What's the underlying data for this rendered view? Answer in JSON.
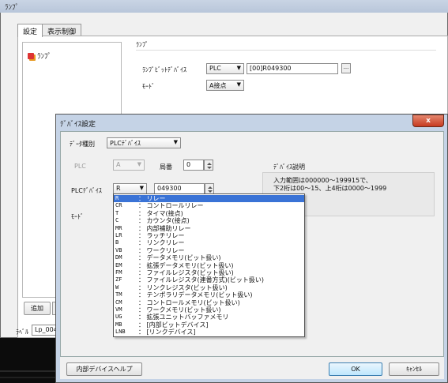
{
  "back_window": {
    "title": "ﾗﾝﾌﾟ",
    "tabs": [
      {
        "label": "設定",
        "active": true
      },
      {
        "label": "表示制御",
        "active": false
      }
    ],
    "tree_item": "ﾗﾝﾌﾟ",
    "group_title": "ﾗﾝﾌﾟ",
    "lamp_bit_device_label": "ﾗﾝﾌﾟﾋﾞｯﾄﾃﾞﾊﾞｲｽ",
    "plc_select_value": "PLC",
    "device_value": "[00]R049300",
    "browse_button": "...",
    "mode_label": "ﾓｰﾄﾞ",
    "mode_value": "A接点",
    "add_button": "追加",
    "label_label": "ﾗﾍﾞﾙ",
    "label_value": "Lp_004"
  },
  "dialog": {
    "title": "ﾃﾞﾊﾞｲｽ設定",
    "close_glyph": "x",
    "device_type_label": "ﾃﾞｰﾀ種別",
    "device_type_value": "PLCﾃﾞﾊﾞｲｽ",
    "plc_label": "PLC",
    "plc_value": "A",
    "station_label": "局番",
    "station_value": "0",
    "device_desc_label": "ﾃﾞﾊﾞｲｽ説明",
    "device_desc_text": "入力範囲は000000～199915で、\n下2桁は00～15、上4桁は0000～1999",
    "plc_device_label": "PLCﾃﾞﾊﾞｲｽ",
    "plc_device_value": "R",
    "address_value": "049300",
    "mode_label": "ﾓｰﾄﾞ",
    "dropdown_items": [
      {
        "code": "R",
        "desc": "： リレー",
        "selected": true
      },
      {
        "code": "CR",
        "desc": "： コントロールリレー",
        "selected": false
      },
      {
        "code": "T",
        "desc": "： タイマ(接点)",
        "selected": false
      },
      {
        "code": "C",
        "desc": "： カウンタ(接点)",
        "selected": false
      },
      {
        "code": "MR",
        "desc": "： 内部補助リレー",
        "selected": false
      },
      {
        "code": "LR",
        "desc": "： ラッチリレー",
        "selected": false
      },
      {
        "code": "B",
        "desc": "： リンクリレー",
        "selected": false
      },
      {
        "code": "VB",
        "desc": "： ワークリレー",
        "selected": false
      },
      {
        "code": "DM",
        "desc": "： データメモリ(ビット扱い)",
        "selected": false
      },
      {
        "code": "EM",
        "desc": "： 拡張データメモリ(ビット扱い)",
        "selected": false
      },
      {
        "code": "FM",
        "desc": "： ファイルレジスタ(ビット扱い)",
        "selected": false
      },
      {
        "code": "ZF",
        "desc": "： ファイルレジスタ(連番方式)(ビット扱い)",
        "selected": false
      },
      {
        "code": "W",
        "desc": "： リンクレジスタ(ビット扱い)",
        "selected": false
      },
      {
        "code": "TM",
        "desc": "： テンポラリデータメモリ(ビット扱い)",
        "selected": false
      },
      {
        "code": "CM",
        "desc": "： コントロールメモリ(ビット扱い)",
        "selected": false
      },
      {
        "code": "VM",
        "desc": "： ワークメモリ(ビット扱い)",
        "selected": false
      },
      {
        "code": "UG",
        "desc": "： 拡張ユニットバッファメモリ",
        "selected": false
      },
      {
        "code": "MB",
        "desc": "： [内部ビットデバイス]",
        "selected": false
      },
      {
        "code": "LNB",
        "desc": "： [リンクデバイス]",
        "selected": false
      }
    ],
    "help_button": "内部デバイスヘルプ",
    "ok_button": "OK",
    "cancel_button": "ｷｬﾝｾﾙ"
  },
  "colors": {
    "selection": "#3a73d6",
    "close_button": "#c63a20",
    "title_bar": "#c5d3e6"
  }
}
